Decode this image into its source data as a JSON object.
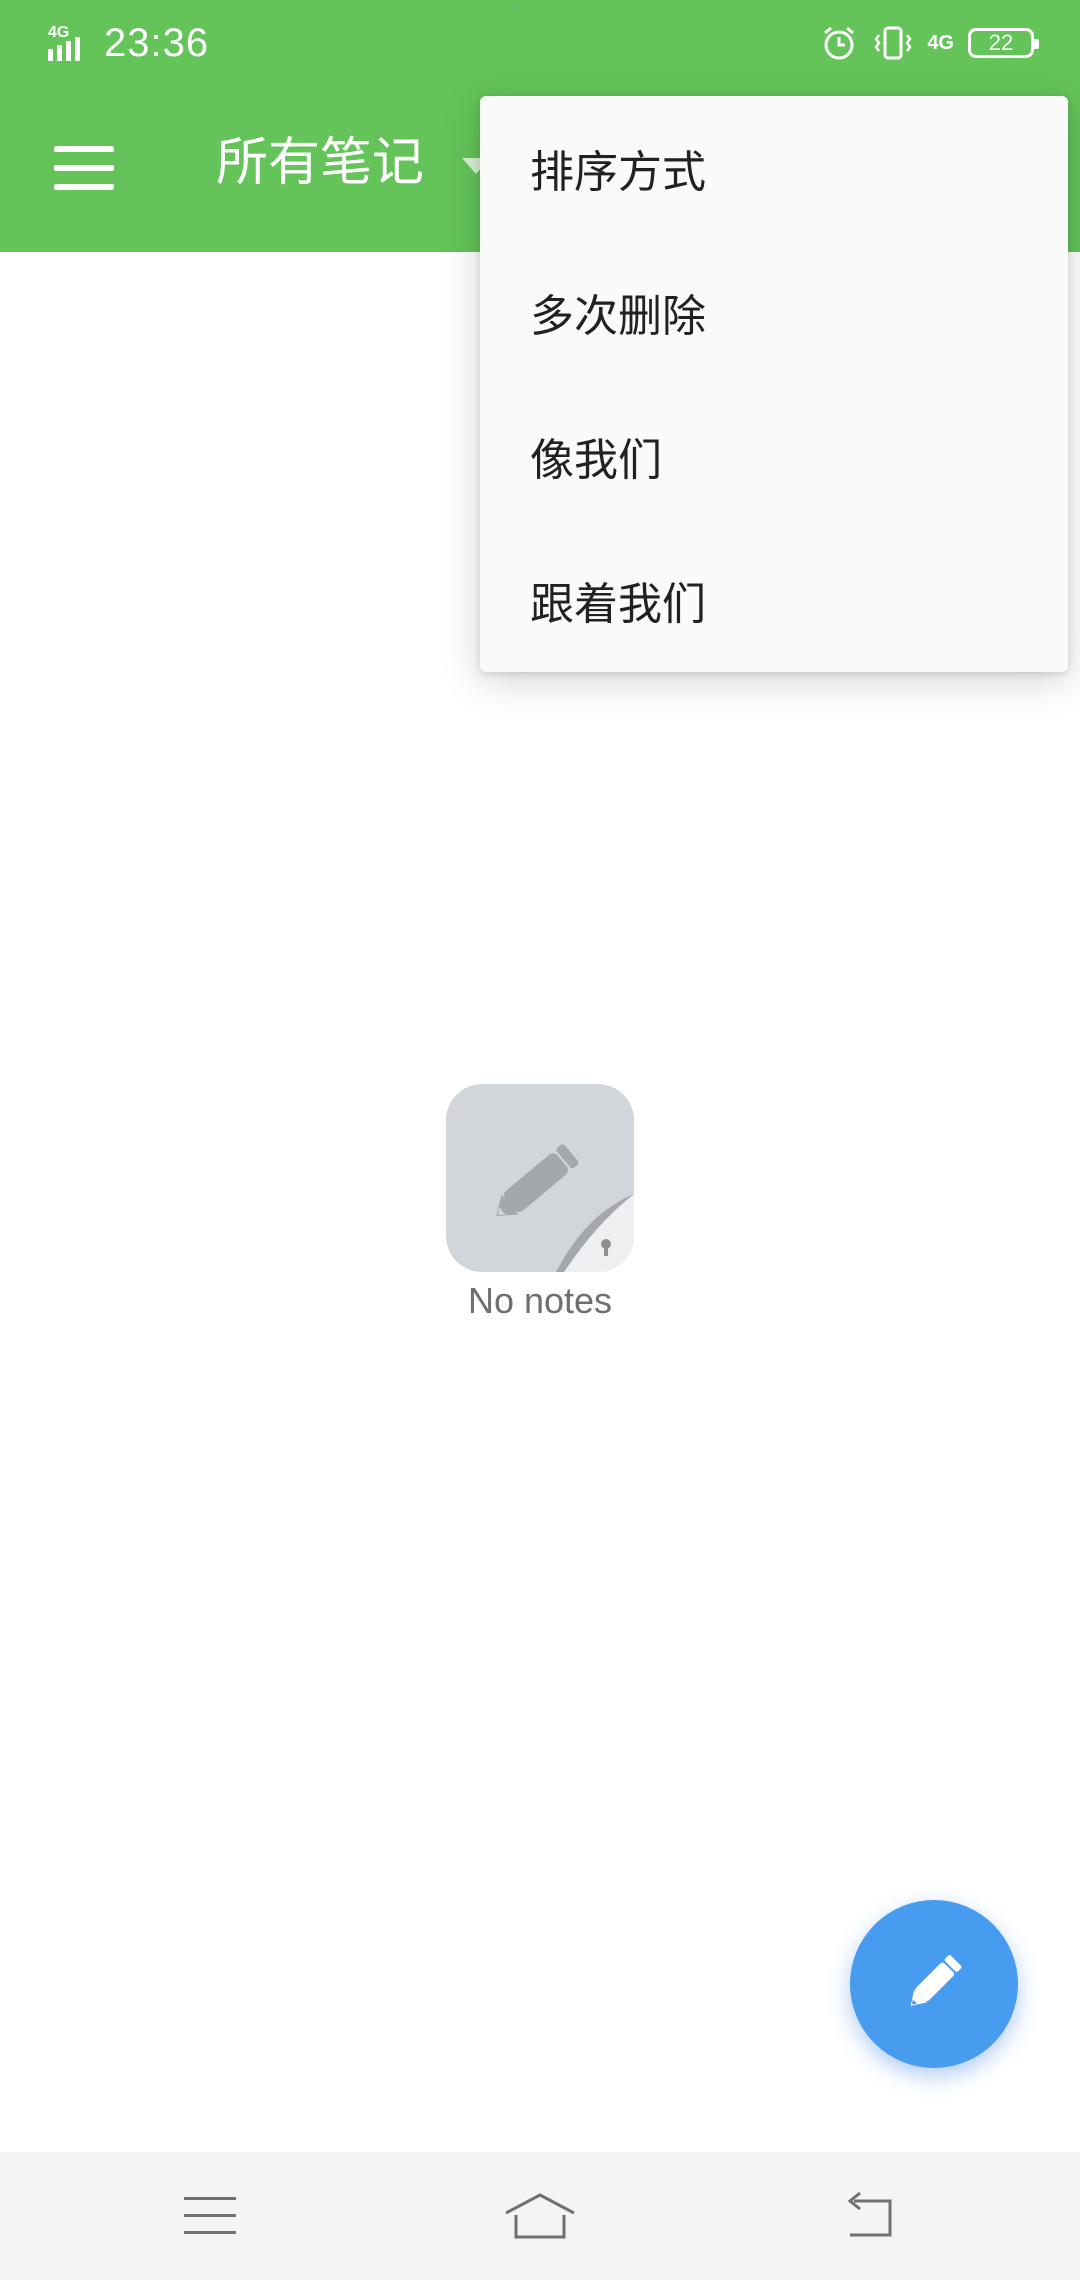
{
  "status_bar": {
    "network": "4G",
    "time": "23:36",
    "right_network": "4G",
    "battery_level": "22",
    "icons": [
      "signal-icon",
      "alarm-icon",
      "vibrate-icon",
      "battery-icon"
    ]
  },
  "app_bar": {
    "title": "所有笔记",
    "menu_icon": "hamburger-menu-icon",
    "dropdown_icon": "caret-down-icon"
  },
  "menu": {
    "items": [
      {
        "label": "排序方式"
      },
      {
        "label": "多次删除"
      },
      {
        "label": "像我们"
      },
      {
        "label": "跟着我们"
      }
    ]
  },
  "empty_state": {
    "icon": "note-pencil-icon",
    "text": "No notes"
  },
  "fab": {
    "icon": "pencil-icon",
    "color": "#479cf0"
  },
  "colors": {
    "primary": "#64c45a",
    "menu_bg": "#fafafa",
    "fab": "#479cf0"
  },
  "nav_bar": {
    "buttons": [
      "menu-icon",
      "home-icon",
      "back-icon"
    ]
  }
}
